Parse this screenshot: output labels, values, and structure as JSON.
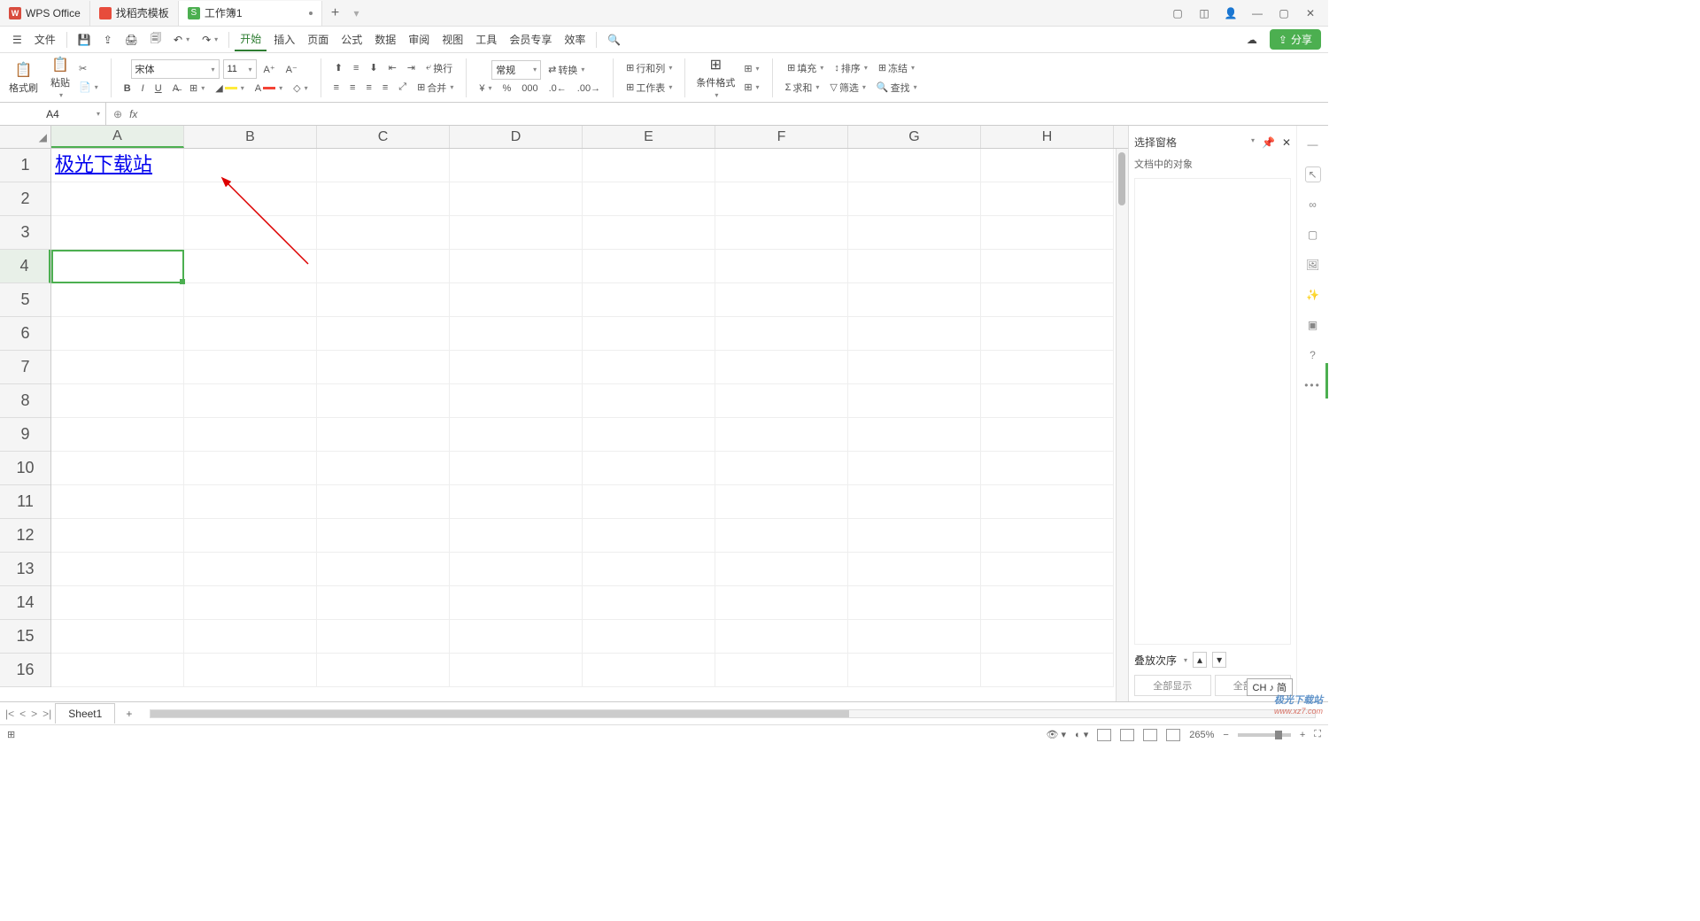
{
  "titlebar": {
    "tabs": [
      {
        "label": "WPS Office",
        "logo": "wps"
      },
      {
        "label": "找稻壳模板",
        "logo": "dao"
      },
      {
        "label": "工作簿1",
        "logo": "sheets",
        "active": true,
        "dirty": true
      }
    ]
  },
  "menu": {
    "file": "文件",
    "items": [
      "开始",
      "插入",
      "页面",
      "公式",
      "数据",
      "审阅",
      "视图",
      "工具",
      "会员专享",
      "效率"
    ],
    "active_index": 0,
    "share": "分享"
  },
  "ribbon": {
    "format_painter": "格式刷",
    "paste": "粘贴",
    "font_name": "宋体",
    "font_size": "11",
    "wrap": "换行",
    "number_format": "常规",
    "convert": "转换",
    "rows_cols": "行和列",
    "worksheet": "工作表",
    "cond_format": "条件格式",
    "fill": "填充",
    "sort": "排序",
    "freeze": "冻结",
    "sum": "求和",
    "filter": "筛选",
    "find": "查找",
    "merge": "合并"
  },
  "formula_bar": {
    "name_box": "A4",
    "fx": "fx"
  },
  "grid": {
    "columns": [
      "A",
      "B",
      "C",
      "D",
      "E",
      "F",
      "G",
      "H"
    ],
    "rows": [
      1,
      2,
      3,
      4,
      5,
      6,
      7,
      8,
      9,
      10,
      11,
      12,
      13,
      14,
      15,
      16
    ],
    "selected_col": "A",
    "selected_row": 4,
    "cells": {
      "A1": {
        "text": "极光下载站",
        "link": true
      }
    }
  },
  "side_panel": {
    "title": "选择窗格",
    "subtitle": "文档中的对象",
    "stack_order": "叠放次序",
    "show_all": "全部显示",
    "hide_all": "全部隐藏"
  },
  "sheet_bar": {
    "sheets": [
      "Sheet1"
    ]
  },
  "status": {
    "zoom": "265%",
    "ime": "CH ♪ 简"
  },
  "watermark": {
    "line1": "极光下载站",
    "line2": "www.xz7.com"
  }
}
